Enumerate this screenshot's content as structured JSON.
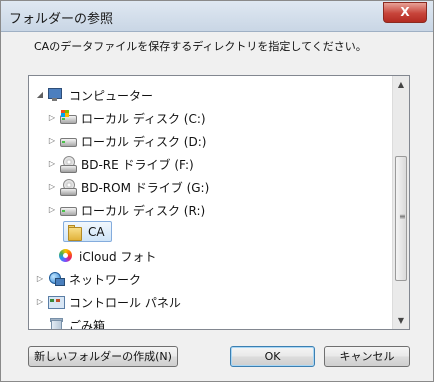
{
  "window": {
    "title": "フォルダーの参照",
    "close_label": "X"
  },
  "instruction": "CAのデータファイルを保存するディレクトリを指定してください。",
  "tree": {
    "items": [
      {
        "label": "コンピューター",
        "icon": "computer-icon",
        "expander": "◢"
      },
      {
        "label": "ローカル ディスク (C:)",
        "icon": "windows-drive-icon",
        "expander": "▷"
      },
      {
        "label": "ローカル ディスク (D:)",
        "icon": "hard-drive-icon",
        "expander": "▷"
      },
      {
        "label": "BD-RE ドライブ (F:)",
        "icon": "bd-drive-icon",
        "expander": "▷"
      },
      {
        "label": "BD-ROM ドライブ (G:)",
        "icon": "bd-drive-icon",
        "expander": "▷"
      },
      {
        "label": "ローカル ディスク (R:)",
        "icon": "hard-drive-icon",
        "expander": "▷"
      },
      {
        "label": "CA",
        "icon": "folder-icon",
        "selected": true
      },
      {
        "label": "iCloud フォト",
        "icon": "icloud-photos-icon"
      },
      {
        "label": "ネットワーク",
        "icon": "network-icon",
        "expander": "▷"
      },
      {
        "label": "コントロール パネル",
        "icon": "control-panel-icon",
        "expander": "▷"
      },
      {
        "label": "ごみ箱",
        "icon": "recycle-bin-icon"
      }
    ]
  },
  "scrollbar": {
    "up": "▲",
    "down": "▼",
    "grip": "≡"
  },
  "buttons": {
    "new_folder": "新しいフォルダーの作成(N)",
    "ok": "OK",
    "cancel": "キャンセル"
  }
}
